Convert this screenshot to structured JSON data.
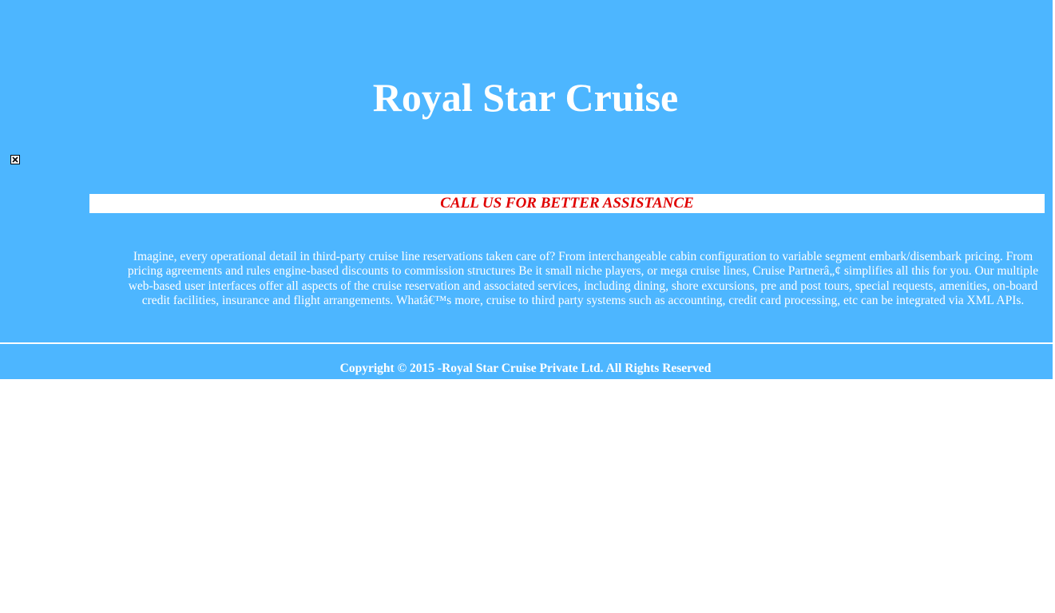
{
  "header": {
    "title": "Royal Star Cruise",
    "logo_icon": "broken-image-icon"
  },
  "banner": {
    "text": "CALL US FOR BETTER ASSISTANCE",
    "text_color": "#e00000"
  },
  "main": {
    "description": "Imagine, every operational detail in third-party cruise line reservations taken care of? From interchangeable cabin configuration to variable segment embark/disembark pricing. From pricing agreements and rules engine-based discounts to commission structures Be it small niche players, or mega cruise lines, Cruise Partnerâ„¢ simplifies all this for you. Our multiple web-based user interfaces offer all aspects of the cruise reservation and associated services, including dining, shore excursions, pre and post tours, special requests, amenities, on-board credit facilities, insurance and flight arrangements. Whatâ€™s more, cruise to third party systems such as accounting, credit card processing, etc can be integrated via XML APIs."
  },
  "footer": {
    "copyright": "Copyright © 2015 -Royal Star Cruise Private Ltd. All Rights Reserved"
  },
  "colors": {
    "background": "#4db6ff",
    "text": "#ffffff"
  }
}
